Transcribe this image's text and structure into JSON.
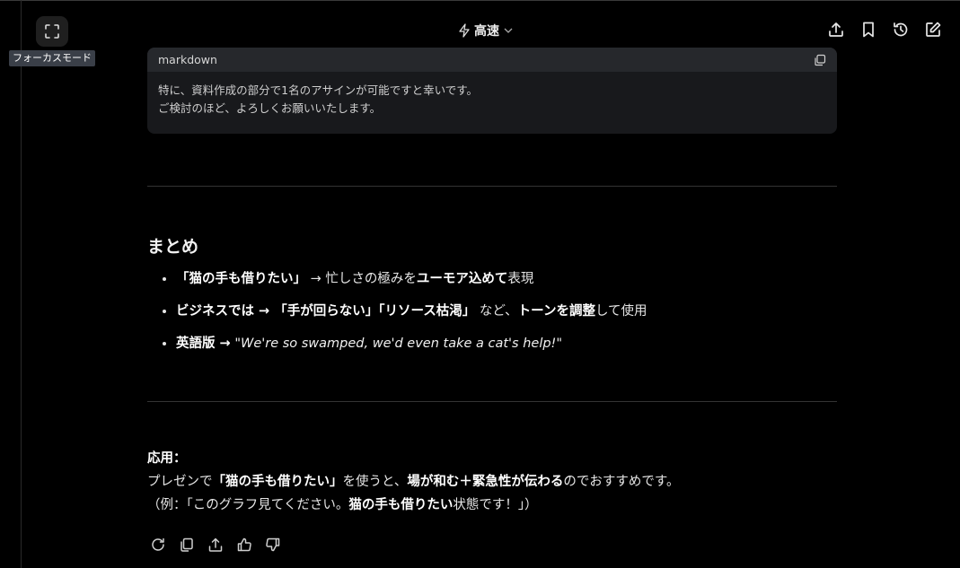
{
  "header": {
    "focus_tooltip": "フォーカスモード",
    "mode_label": "高速"
  },
  "code_block": {
    "language": "markdown",
    "lines": [
      "特に、資料作成の部分で1名のアサインが可能ですと幸いです。",
      "ご検討のほど、よろしくお願いいたします。"
    ]
  },
  "summary": {
    "heading": "まとめ",
    "items": [
      {
        "p1": "「猫の手も借りたい」",
        "p2": " → 忙しさの極みを",
        "p3": "ユーモア込めて",
        "p4": "表現"
      },
      {
        "p1": "ビジネスでは → 「手が回らない」「リソース枯渇」",
        "p2": " など、",
        "p3": "トーンを調整",
        "p4": "して使用"
      },
      {
        "p1": "英語版 →",
        "p2": " ",
        "p3": "\"We're so swamped, we'd even take a cat's help!\"",
        "p4": ""
      }
    ]
  },
  "application": {
    "label": "応用：",
    "line1": {
      "a": "プレゼンで",
      "b": "「猫の手も借りたい」",
      "c": "を使うと、",
      "d": "場が和む＋緊急性が伝わる",
      "e": "のでおすすめです。"
    },
    "line2": {
      "a": "（例：「このグラフ見てください。",
      "b": "猫の手も借りたい",
      "c": "状態です！」）"
    }
  }
}
